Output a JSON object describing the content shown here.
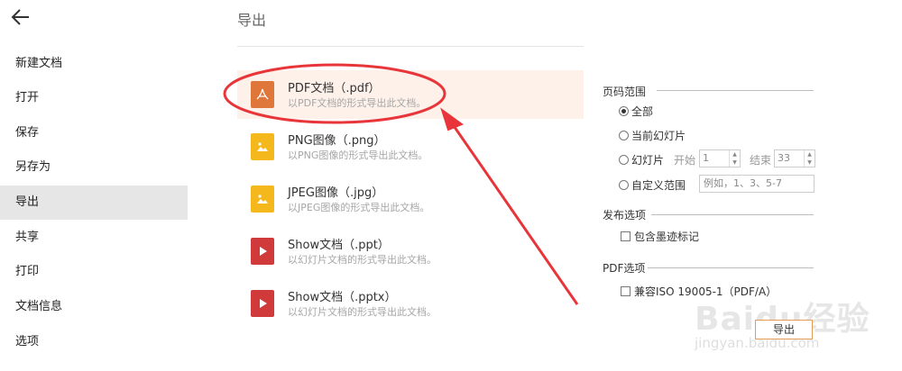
{
  "sidebar": {
    "items": [
      {
        "label": "新建文档"
      },
      {
        "label": "打开"
      },
      {
        "label": "保存"
      },
      {
        "label": "另存为"
      },
      {
        "label": "导出"
      },
      {
        "label": "共享"
      },
      {
        "label": "打印"
      },
      {
        "label": "文档信息"
      },
      {
        "label": "选项"
      }
    ],
    "active_index": 4
  },
  "main": {
    "title": "导出",
    "formats": [
      {
        "name": "PDF文档（.pdf）",
        "desc": "以PDF文档的形式导出此文档。",
        "icon": "pdf-icon",
        "color": "#e0773a"
      },
      {
        "name": "PNG图像（.png）",
        "desc": "以PNG图像的形式导出此文档。",
        "icon": "image-icon",
        "color": "#f5b81c"
      },
      {
        "name": "JPEG图像（.jpg）",
        "desc": "以JPEG图像的形式导出此文档。",
        "icon": "image-icon",
        "color": "#f5b81c"
      },
      {
        "name": "Show文档（.ppt）",
        "desc": "以幻灯片文档的形式导出此文档。",
        "icon": "play-icon",
        "color": "#d03a3a"
      },
      {
        "name": "Show文档（.pptx）",
        "desc": "以幻灯片文档的形式导出此文档。",
        "icon": "play-icon",
        "color": "#d03a3a"
      }
    ]
  },
  "options": {
    "page_range": {
      "title": "页码范围",
      "all": "全部",
      "current": "当前幻灯片",
      "slides": "幻灯片",
      "start_label": "开始",
      "start_value": "1",
      "end_label": "结束",
      "end_value": "33",
      "custom": "自定义范围",
      "custom_placeholder": "例如，1、3、5-7"
    },
    "publish": {
      "title": "发布选项",
      "ink": "包含墨迹标记"
    },
    "pdf": {
      "title": "PDF选项",
      "compat": "兼容ISO 19005-1（PDF/A）"
    },
    "export_label": "导出"
  },
  "watermark": {
    "brand": "Baidu经验",
    "url": "jingyan.baidu.com"
  },
  "colors": {
    "accent": "#e0773a",
    "annotation": "#e8353a",
    "selected_bg": "#fdf1ea"
  }
}
